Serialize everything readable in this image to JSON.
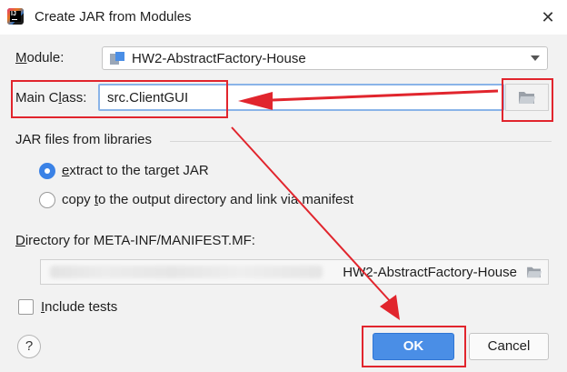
{
  "window": {
    "title": "Create JAR from Modules",
    "close_symbol": "✕",
    "app_icon_text": "IJ"
  },
  "module": {
    "label_pre": "",
    "label_mnemonic": "M",
    "label_post": "odule:",
    "value": "HW2-AbstractFactory-House"
  },
  "main_class": {
    "label_pre": "Main C",
    "label_mnemonic": "l",
    "label_post": "ass:",
    "value": "src.ClientGUI"
  },
  "libraries": {
    "section_label": "JAR files from libraries",
    "option_extract_pre": "",
    "option_extract_mnemonic": "e",
    "option_extract_post": "xtract to the target JAR",
    "option_copy_pre": "copy ",
    "option_copy_mnemonic": "t",
    "option_copy_post": "o the output directory and link via manifest",
    "selected": "extract"
  },
  "manifest_dir": {
    "label_pre": "",
    "label_mnemonic": "D",
    "label_post": "irectory for META-INF/MANIFEST.MF:",
    "value_visible": "HW2-AbstractFactory-House"
  },
  "include_tests": {
    "label_pre": "",
    "label_mnemonic": "I",
    "label_post": "nclude tests",
    "checked": false
  },
  "footer": {
    "help_symbol": "?",
    "ok_label": "OK",
    "cancel_label": "Cancel"
  },
  "colors": {
    "accent": "#4a8ee6",
    "annotation_red": "#e1252d",
    "focus_border": "#8ab4e8"
  }
}
